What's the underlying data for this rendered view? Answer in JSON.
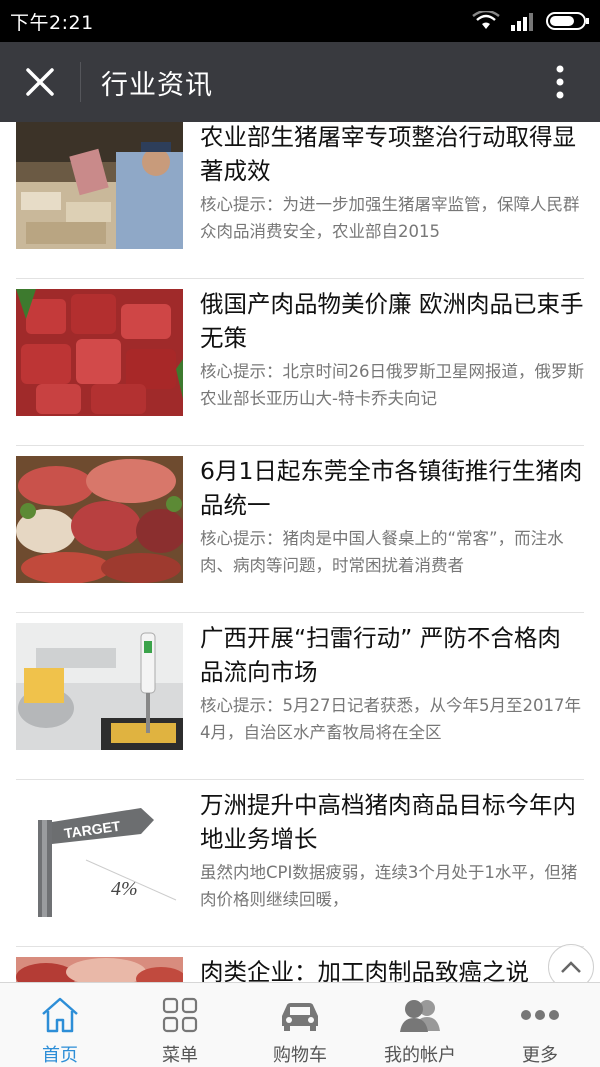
{
  "status_bar": {
    "time": "下午2:21"
  },
  "header": {
    "title": "行业资讯"
  },
  "articles": [
    {
      "title": "农业部生猪屠宰专项整治行动取得显著成效",
      "summary": "核心提示：为进一步加强生猪屠宰监管，保障人民群众肉品消费安全，农业部自2015"
    },
    {
      "title": "俄国产肉品物美价廉 欧洲肉品已束手无策",
      "summary": "核心提示：北京时间26日俄罗斯卫星网报道，俄罗斯农业部长亚历山大-特卡乔夫向记"
    },
    {
      "title": "6月1日起东莞全市各镇街推行生猪肉品统一",
      "summary": "核心提示：猪肉是中国人餐桌上的“常客”，而注水肉、病肉等问题，时常困扰着消费者"
    },
    {
      "title": "广西开展“扫雷行动” 严防不合格肉品流向市场",
      "summary": "核心提示：5月27日记者获悉，从今年5月至2017年4月，自治区水产畜牧局将在全区"
    },
    {
      "title": "万洲提升中高档猪肉商品目标今年内地业务增长",
      "summary": "虽然内地CPI数据疲弱，连续3个月处于1水平，但猪肉价格则继续回暖，",
      "image_text": {
        "sign": "TARGET",
        "figure": "4%"
      }
    },
    {
      "title": "肉类企业：加工肉制品致癌之说",
      "summary": ""
    }
  ],
  "tabs": [
    {
      "label": "首页",
      "icon": "home-icon"
    },
    {
      "label": "菜单",
      "icon": "grid-icon"
    },
    {
      "label": "购物车",
      "icon": "car-icon"
    },
    {
      "label": "我的帐户",
      "icon": "users-icon"
    },
    {
      "label": "更多",
      "icon": "more-dots-icon"
    }
  ],
  "colors": {
    "title_bar": "#393a3f",
    "active_tab": "#2d8ed7",
    "status_bar": "#000000"
  }
}
